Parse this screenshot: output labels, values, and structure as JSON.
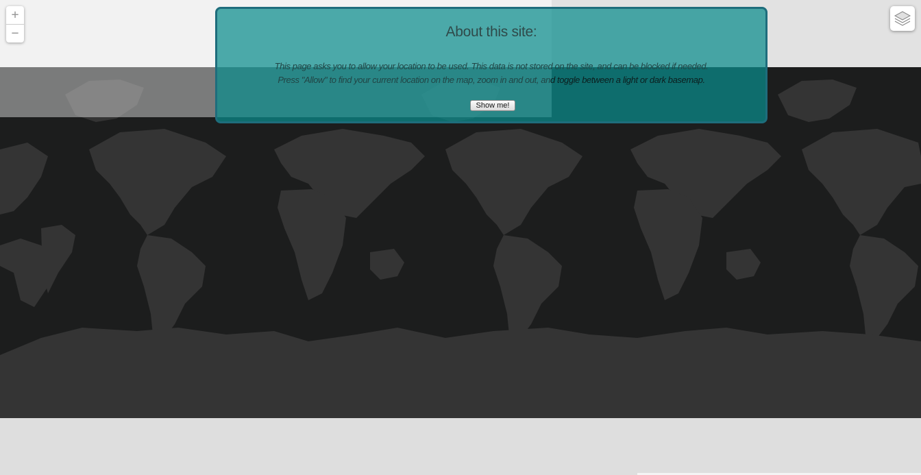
{
  "map": {
    "zoom_in_label": "+",
    "zoom_out_label": "−",
    "layers_icon": "layers-icon",
    "land_color": "#343434",
    "ocean_color": "#1c1d1d"
  },
  "about": {
    "title": "About this site:",
    "line1": "This page asks you to allow your location to be used. This data is not stored on the site, and can be blocked if needed.",
    "line2_part1": "Press \"Allow\" to find your current location on the map, zoom in and out, an",
    "line2_part2": "d toggle between a light or dark basemap.",
    "button_label": "Show me!",
    "panel_color": "#0a8c8c"
  }
}
